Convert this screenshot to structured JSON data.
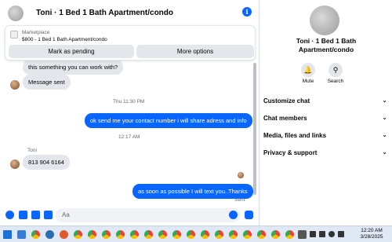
{
  "header": {
    "title": "Toni · 1 Bed 1 Bath Apartment/condo"
  },
  "marketplace": {
    "label": "Marketplace",
    "listing": "$800 - 1 Bed 1 Bath Apartment/condo",
    "mark_pending_label": "Mark as pending",
    "more_options_label": "More options"
  },
  "messages": {
    "partial_incoming": "this something you can work with?",
    "message_sent": "Message sent",
    "timestamp_1": "Thu 11:30 PM",
    "outgoing_1": "ok send me your contact number i will share adress and info",
    "timestamp_2": "12:17 AM",
    "sender_name": "Toni",
    "incoming_phone": "813 904 6164",
    "outgoing_2": "as soon as possible I will text you..Thanks",
    "status": "Sent"
  },
  "composer": {
    "placeholder": "Aa"
  },
  "details": {
    "name": "Toni · 1 Bed 1 Bath\nApartment/condo",
    "mute_label": "Mute",
    "search_label": "Search",
    "sections": [
      "Customize chat",
      "Chat members",
      "Media, files and links",
      "Privacy & support"
    ]
  },
  "taskbar": {
    "time": "12:20 AM",
    "date": "3/28/2025"
  },
  "colors": {
    "accent": "#0866ff",
    "bubble_in": "#e4e6eb",
    "background": "#ffffff"
  }
}
